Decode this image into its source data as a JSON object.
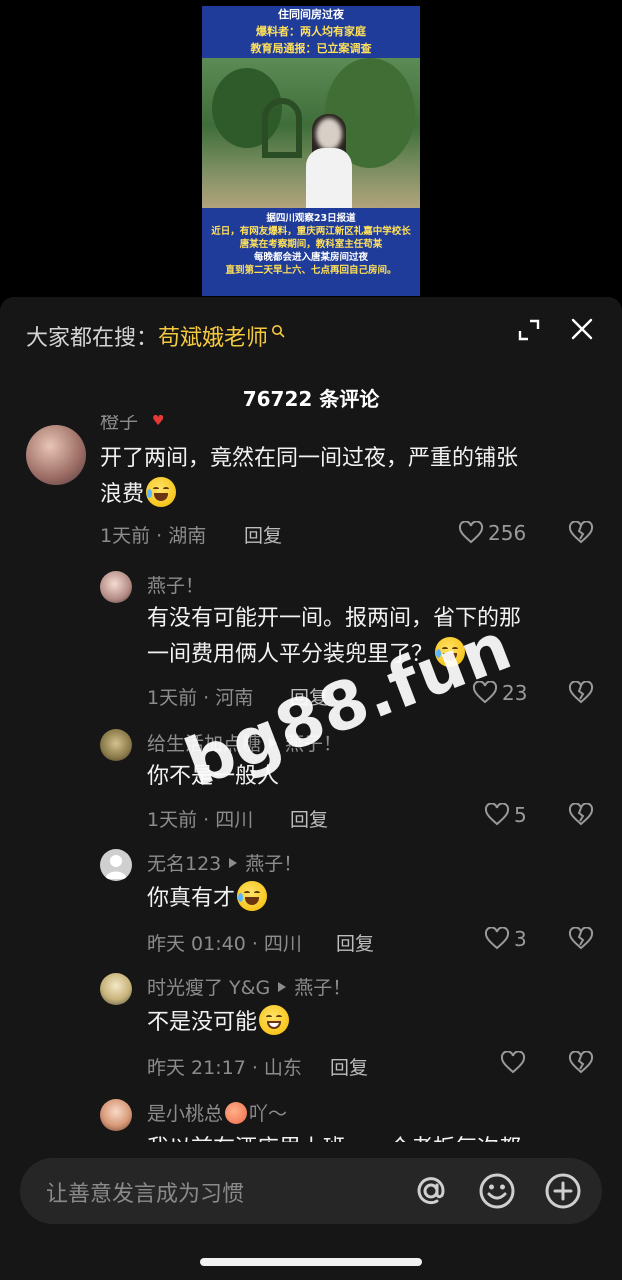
{
  "video": {
    "top_lines": [
      {
        "text": "住同间房过夜",
        "highlight": false
      },
      {
        "text": "爆料者：两人均有家庭",
        "highlight": true
      },
      {
        "text": "教育局通报：已立案调查",
        "highlight": true
      }
    ],
    "body_lines": [
      {
        "text": "据四川观察23日报道",
        "highlight": false
      },
      {
        "text": "近日，有网友爆料，重庆两江新区礼嘉中学校长",
        "highlight": true
      },
      {
        "text": "唐某在考察期间，教科室主任苟某",
        "highlight": true
      },
      {
        "text": "每晚都会进入唐某房间过夜",
        "highlight": false
      },
      {
        "text": "直到第二天早上六、七点再回自己房间。",
        "highlight": true
      }
    ]
  },
  "sheet": {
    "search_prefix": "大家都在搜：",
    "search_term": "苟斌娥老师",
    "count_label": "76722 条评论"
  },
  "comments": [
    {
      "name": "橙子",
      "text_line1": "开了两间，竟然在同一间过夜，严重的铺张",
      "text_line2": "浪费",
      "emoji": "laugh-cry",
      "meta": "1天前 · 湖南",
      "reply_label": "回复",
      "likes": "256"
    },
    {
      "name": "燕子！",
      "text_line1": "有没有可能开一间。报两间，省下的那",
      "text_line2": "一间费用俩人平分装兜里了？",
      "emoji": "rofl",
      "meta": "1天前 · 河南",
      "reply_label": "回复",
      "likes": "23"
    },
    {
      "name": "给生活加点糖",
      "reply_to": "燕子！",
      "text_line1": "你不是一般人",
      "meta": "1天前 · 四川",
      "reply_label": "回复",
      "likes": "5"
    },
    {
      "name": "无名123",
      "reply_to": "燕子！",
      "text_line1": "你真有才",
      "emoji": "rofl",
      "meta": "昨天 01:40 · 四川",
      "reply_label": "回复",
      "likes": "3"
    },
    {
      "name": "时光瘦了 Y&G",
      "reply_to": "燕子！",
      "text_line1": "不是没可能",
      "emoji": "grin",
      "meta": "昨天 21:17 · 山东",
      "reply_label": "回复",
      "likes": ""
    },
    {
      "name": "是小桃总",
      "name_suffix": "吖～",
      "text_line1": "我以前在酒店里上班……个老板每次都"
    }
  ],
  "input": {
    "placeholder": "让善意发言成为习惯"
  },
  "watermark": "bg88.fun",
  "colors": {
    "sheet_bg": "#161616",
    "search_term": "#f4c93f",
    "muted_text": "#8c8c8c",
    "video_bg": "#1f3c9a",
    "video_highlight": "#ffe05a"
  }
}
